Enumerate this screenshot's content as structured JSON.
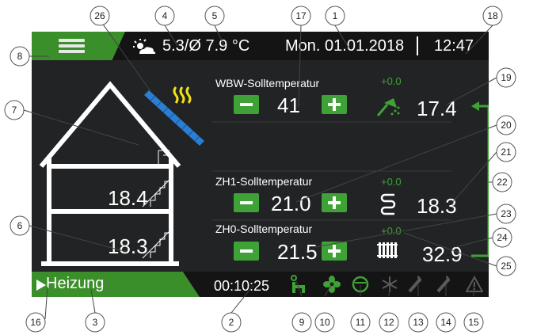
{
  "topbar": {
    "outdoor_temp": "5.3/Ø 7.9 °C",
    "date": "Mon. 01.01.2018",
    "time": "12:47",
    "menu_icon": "hamburger-menu-icon",
    "weather_icon": "sun-cloud-icon"
  },
  "dhw": {
    "label": "WBW-Solltemperatur",
    "setpoint": "41",
    "offset": "+0.0",
    "actual": "17.4",
    "icon": "shower-icon"
  },
  "zh1": {
    "label": "ZH1-Solltemperatur",
    "setpoint": "21.0",
    "offset": "+0.0",
    "actual": "18.3",
    "icon": "floor-heating-icon"
  },
  "zh0": {
    "label": "ZH0-Solltemperatur",
    "setpoint": "21.5",
    "offset": "+0.0",
    "actual": "32.9",
    "icon": "radiator-icon"
  },
  "house": {
    "upper_temp": "18.4",
    "lower_temp": "18.3"
  },
  "bottombar": {
    "mode": "Heizung",
    "runtime": "00:10:25",
    "status_icons": [
      "pump-icon",
      "fan-icon",
      "compressor-icon",
      "defrost-icon",
      "burner-icon",
      "burner2-icon",
      "warning-icon"
    ]
  },
  "callouts": [
    "1",
    "2",
    "3",
    "4",
    "5",
    "6",
    "7",
    "8",
    "9",
    "10",
    "11",
    "12",
    "13",
    "14",
    "15",
    "16",
    "17",
    "18",
    "19",
    "20",
    "21",
    "22",
    "23",
    "24",
    "25",
    "26"
  ],
  "colors": {
    "accent": "#3fa236",
    "accent_dark": "#3b8f2a",
    "background": "#222324",
    "text": "#ffffff",
    "solar": "#2a7fd4",
    "heat": "#f2e21a"
  }
}
